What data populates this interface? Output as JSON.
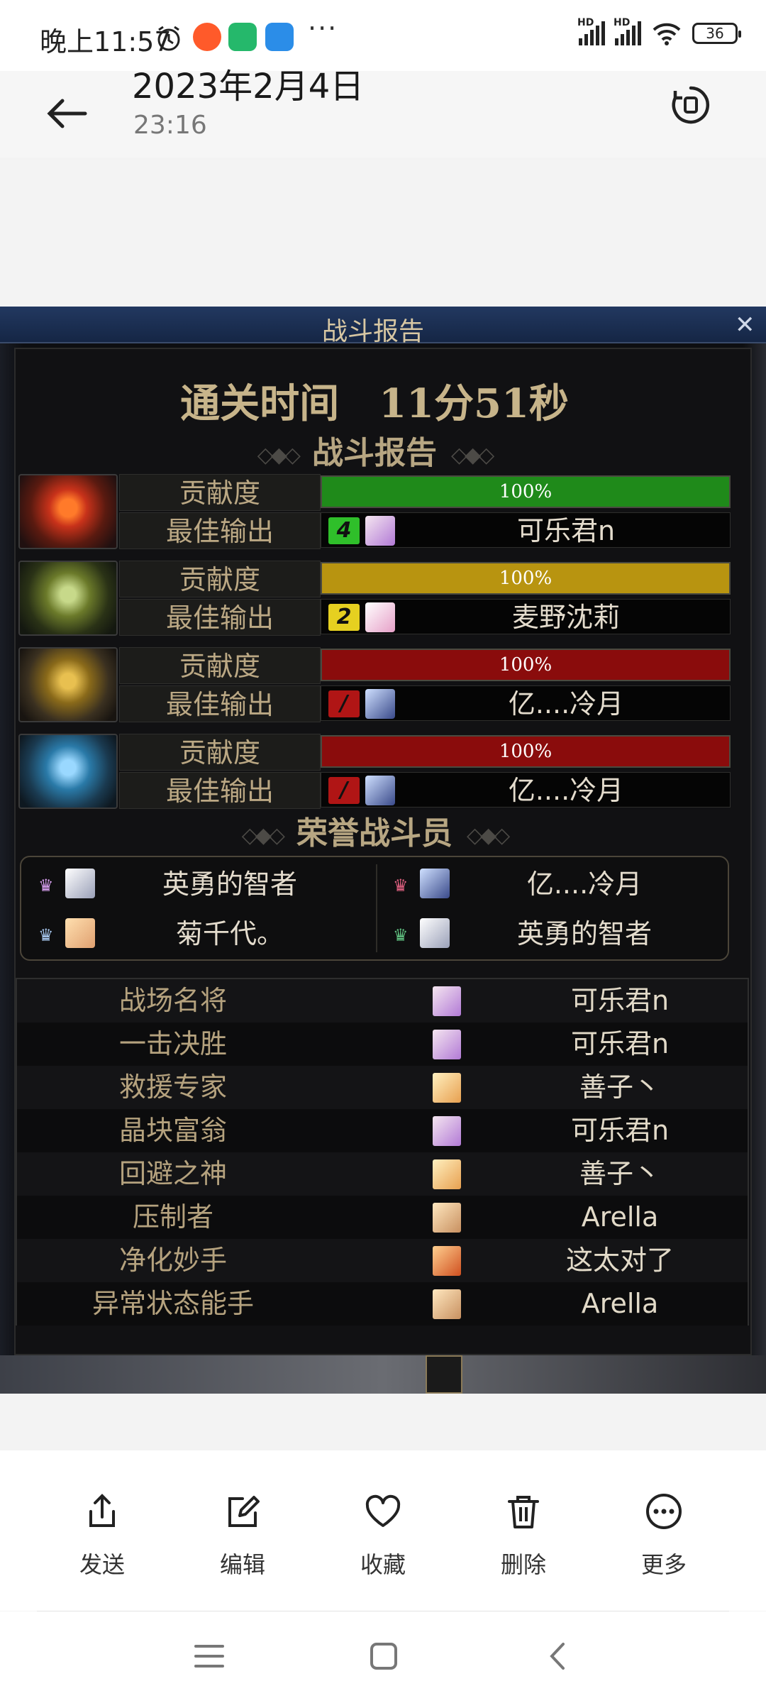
{
  "status_bar": {
    "time": "晚上11:57",
    "more": "···",
    "hd1": "HD",
    "hd2": "HD",
    "battery": "36"
  },
  "header": {
    "date": "2023年2月4日",
    "time": "23:16"
  },
  "game": {
    "window_title": "战斗报告",
    "close": "✕",
    "clear_time": "通关时间　11分51秒",
    "report_heading": "战斗报告",
    "contribution_label": "贡献度",
    "best_output_label": "最佳输出",
    "bosses": [
      {
        "contribution": "100%",
        "contribution_value": 100,
        "bar_color": "#1f8a1a",
        "rank": "4",
        "rank_color": "#2fbf2a",
        "best_player": "可乐君n"
      },
      {
        "contribution": "100%",
        "contribution_value": 100,
        "bar_color": "#b89410",
        "rank": "2",
        "rank_color": "#e6d020",
        "best_player": "麦野沈莉"
      },
      {
        "contribution": "100%",
        "contribution_value": 100,
        "bar_color": "#8a0c0c",
        "rank": "/",
        "rank_color": "#b01515",
        "best_player": "亿....冷月"
      },
      {
        "contribution": "100%",
        "contribution_value": 100,
        "bar_color": "#8a0c0c",
        "rank": "/",
        "rank_color": "#b01515",
        "best_player": "亿....冷月"
      }
    ],
    "honor_heading": "荣誉战斗员",
    "honor": [
      "英勇的智者",
      "亿....冷月",
      "菊千代。",
      "英勇的智者"
    ],
    "awards": [
      {
        "title": "战场名将",
        "player": "可乐君n"
      },
      {
        "title": "一击决胜",
        "player": "可乐君n"
      },
      {
        "title": "救援专家",
        "player": "善子丶"
      },
      {
        "title": "晶块富翁",
        "player": "可乐君n"
      },
      {
        "title": "回避之神",
        "player": "善子丶"
      },
      {
        "title": "压制者",
        "player": "Arella"
      },
      {
        "title": "净化妙手",
        "player": "这太对了"
      },
      {
        "title": "异常状态能手",
        "player": "Arella"
      }
    ]
  },
  "toolbar": {
    "send": "发送",
    "edit": "编辑",
    "favorite": "收藏",
    "delete": "删除",
    "more": "更多"
  }
}
